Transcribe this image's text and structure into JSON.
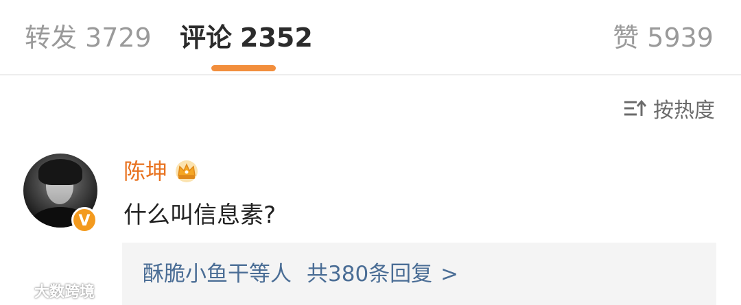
{
  "tabs": {
    "repost": {
      "label": "转发",
      "count": "3729"
    },
    "comment": {
      "label": "评论",
      "count": "2352"
    },
    "like": {
      "label": "赞",
      "count": "5939"
    }
  },
  "sort": {
    "label": "按热度",
    "icon": "sort-icon"
  },
  "comment": {
    "username": "陈坤",
    "badge_icon": "crown-icon",
    "verified_icon": "verified-v-icon",
    "verified_text": "V",
    "text": "什么叫信息素?",
    "replies": {
      "users": "酥脆小鱼干等人",
      "total": "共380条回复",
      "arrow": ">"
    }
  },
  "watermark": {
    "text": "大数跨境",
    "icon": "watermark-logo-icon"
  },
  "colors": {
    "accent": "#f28e3c",
    "username": "#e8721f",
    "reply_link": "#4a6d95",
    "inactive_tab": "#9a9a9a"
  }
}
